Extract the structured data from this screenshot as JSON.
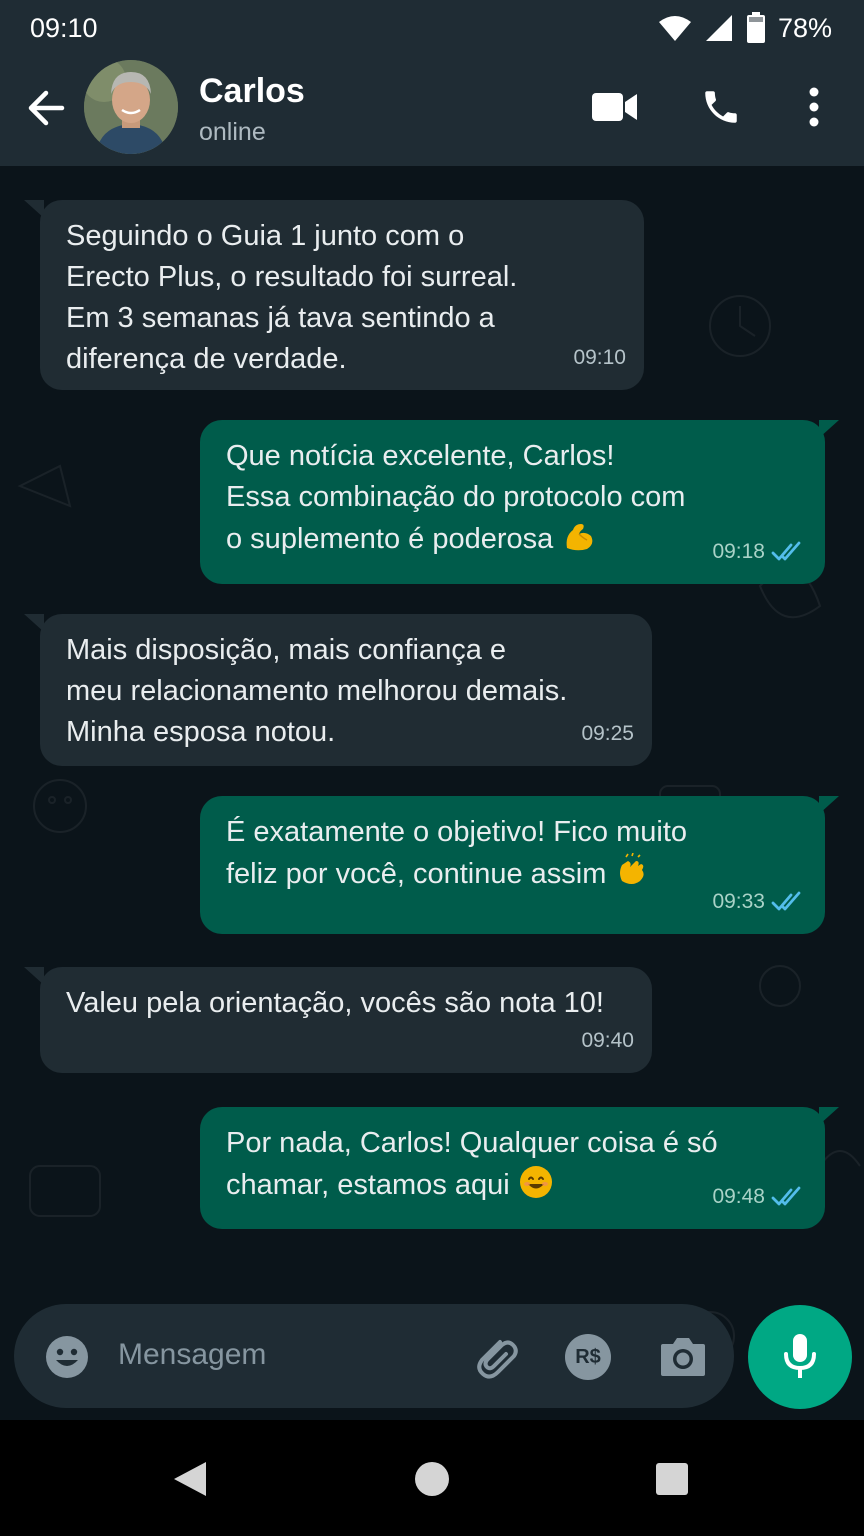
{
  "status_bar": {
    "time": "09:10",
    "battery": "78%"
  },
  "header": {
    "name": "Carlos",
    "status": "online"
  },
  "messages": [
    {
      "direction": "in",
      "text": "Seguindo o Guia 1 junto com o\nErecto Plus, o resultado foi surreal.\nEm 3 semanas já tava sentindo a\ndiferença de verdade.",
      "time": "09:10"
    },
    {
      "direction": "out",
      "text": "Que notícia excelente, Carlos!\nEssa combinação do protocolo com\no suplemento é poderosa",
      "emoji": "flexed-biceps",
      "time": "09:18",
      "read": true
    },
    {
      "direction": "in",
      "text": "Mais disposição, mais confiança e\nmeu relacionamento melhorou demais.\nMinha esposa notou.",
      "time": "09:25"
    },
    {
      "direction": "out",
      "text": "É exatamente o objetivo! Fico muito\nfeliz por você, continue assim",
      "emoji": "clapping-hands",
      "time": "09:33",
      "read": true
    },
    {
      "direction": "in",
      "text": "Valeu pela orientação, vocês são nota 10!",
      "time": "09:40"
    },
    {
      "direction": "out",
      "text": "Por nada, Carlos! Qualquer coisa é só\nchamar, estamos aqui",
      "emoji": "smiling-face",
      "time": "09:48",
      "read": true
    }
  ],
  "composer": {
    "placeholder": "Mensagem",
    "pay_label": "R$"
  },
  "colors": {
    "incoming": "#202c33",
    "outgoing": "#005c4b",
    "accent": "#00a884",
    "read_ticks": "#53bdeb"
  }
}
